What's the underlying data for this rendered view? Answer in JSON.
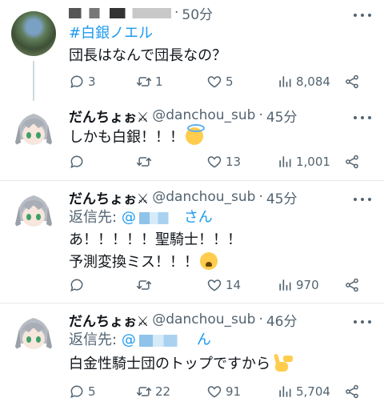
{
  "tweets": [
    {
      "name": "",
      "time": "50分",
      "lines": [
        "#白銀ノエル",
        "団長はなんで団長なの？"
      ],
      "counts": {
        "reply": "3",
        "retweet": "1",
        "like": "5",
        "views": "8,084"
      }
    },
    {
      "name": "だんちょぉ⚔",
      "handle": "@danchou_sub",
      "time": "45分",
      "lines": [
        "しかも白銀！！！"
      ],
      "counts": {
        "reply": "",
        "retweet": "",
        "like": "13",
        "views": "1,001"
      }
    },
    {
      "name": "だんちょぉ⚔",
      "handle": "@danchou_sub",
      "time": "45分",
      "reply_to_label": "返信先:",
      "reply_to_prefix": "@",
      "reply_to_suffix": "さん",
      "lines": [
        "あ！！！！！聖騎士！！！",
        "予測変換ミス！！！"
      ],
      "counts": {
        "reply": "",
        "retweet": "",
        "like": "14",
        "views": "970"
      }
    },
    {
      "name": "だんちょぉ⚔",
      "handle": "@danchou_sub",
      "time": "46分",
      "reply_to_label": "返信先:",
      "reply_to_prefix": "@",
      "reply_to_suffix": "ん",
      "lines": [
        "白金性騎士団のトップですから"
      ],
      "counts": {
        "reply": "5",
        "retweet": "22",
        "like": "91",
        "views": "5,704"
      }
    }
  ],
  "dot": "·",
  "icons": {
    "reply": "reply-icon",
    "retweet": "retweet-icon",
    "like": "heart-icon",
    "views": "views-icon",
    "share": "share-icon",
    "more": "more-icon",
    "emoji_halo": "smiling-face-with-halo",
    "emoji_cry": "loudly-crying-face",
    "emoji_victory": "victory-hand"
  },
  "colors": {
    "link": "#1d9bf0",
    "secondary": "#536471",
    "text": "#0f1419"
  }
}
